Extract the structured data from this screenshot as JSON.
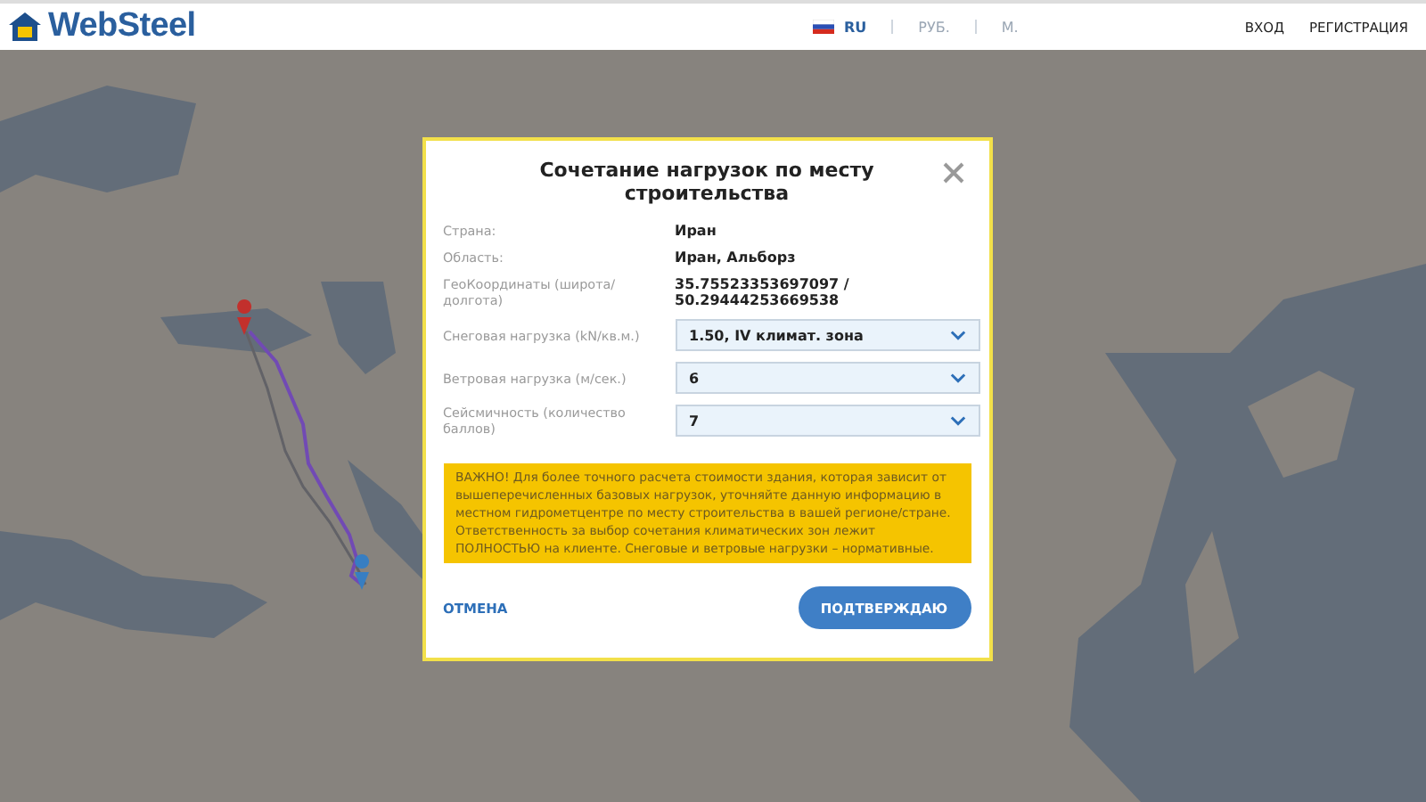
{
  "header": {
    "logo": "WebSteel",
    "language": "RU",
    "currency": "РУБ.",
    "unit": "М.",
    "links": [
      "ВХОД",
      "РЕГИСТРАЦИЯ"
    ]
  },
  "modal": {
    "title": "Сочетание нагрузок по месту строительства",
    "info": [
      {
        "label": "Страна:",
        "value": "Иран"
      },
      {
        "label": "Область:",
        "value": "Иран, Альборз"
      },
      {
        "label": "ГеоКоординаты (широта/долгота)",
        "value": "35.75523353697097 / 50.29444253669538"
      }
    ],
    "selects": [
      {
        "label": "Снеговая нагрузка (kN/кв.м.)",
        "value": "1.50, IV климат. зона"
      },
      {
        "label": "Ветровая нагрузка (м/сек.)",
        "value": "6"
      },
      {
        "label": "Сейсмичность (количество баллов)",
        "value": "7"
      }
    ],
    "warning": "ВАЖНО! Для более точного расчета стоимости здания, которая зависит от вышеперечисленных базовых нагрузок, уточняйте данную информацию в местном гидрометцентре по месту строительства в вашей регионе/стране. Ответственность за выбор сочетания климатических зон лежит ПОЛНОСТЬЮ на клиенте. Снеговые и ветровые нагрузки – нормативные.",
    "cancel": "ОТМЕНА",
    "confirm": "ПОДТВЕРЖДАЮ"
  }
}
